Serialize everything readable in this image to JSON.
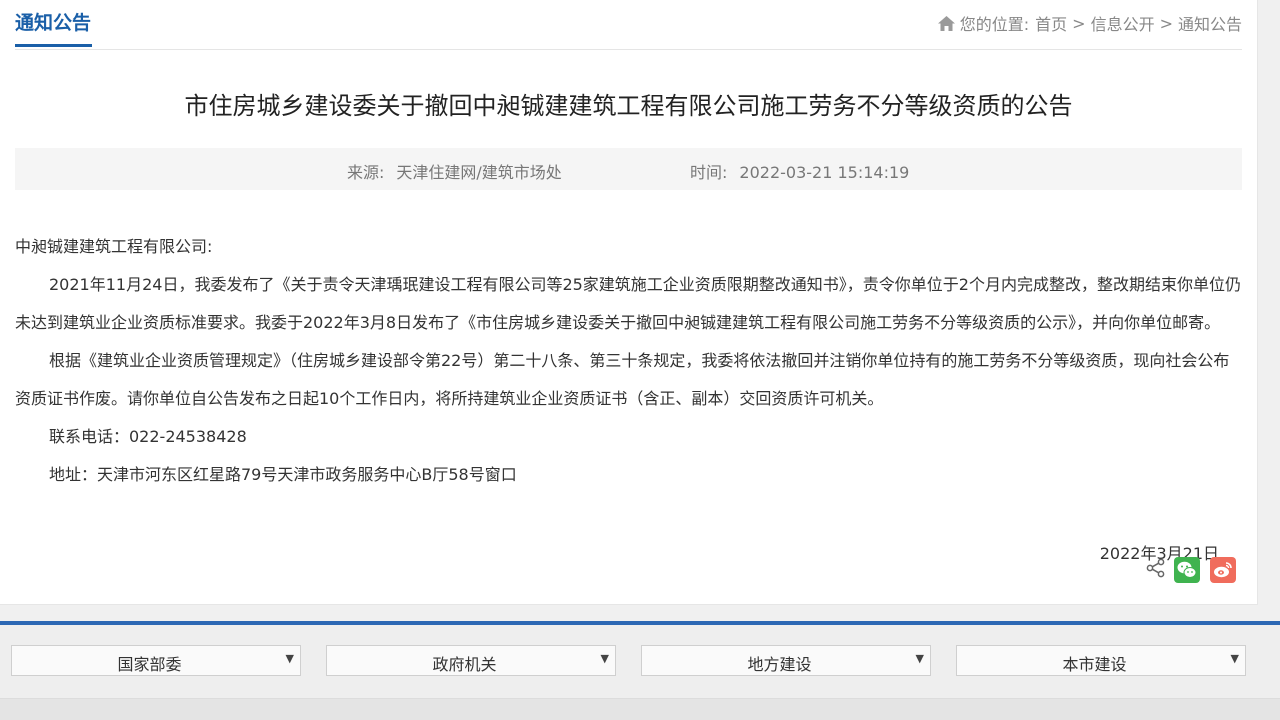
{
  "header": {
    "section_title": "通知公告",
    "breadcrumb_prefix": "您的位置:",
    "breadcrumb": [
      "首页",
      "信息公开",
      "通知公告"
    ],
    "separator": ">"
  },
  "article": {
    "title": "市住房城乡建设委关于撤回中昶铖建建筑工程有限公司施工劳务不分等级资质的公告",
    "source_label": "来源:",
    "source_value": "天津住建网/建筑市场处",
    "time_label": "时间:",
    "time_value": "2022-03-21 15:14:19",
    "salutation": "中昶铖建建筑工程有限公司:",
    "paragraph_1": "2021年11月24日，我委发布了《关于责令天津瑀珉建设工程有限公司等25家建筑施工企业资质限期整改通知书》，责令你单位于2个月内完成整改，整改期结束你单位仍未达到建筑业企业资质标准要求。我委于2022年3月8日发布了《市住房城乡建设委关于撤回中昶铖建建筑工程有限公司施工劳务不分等级资质的公示》，并向你单位邮寄。",
    "paragraph_2": "根据《建筑业企业资质管理规定》（住房城乡建设部令第22号）第二十八条、第三十条规定，我委将依法撤回并注销你单位持有的施工劳务不分等级资质，现向社会公布资质证书作废。请你单位自公告发布之日起10个工作日内，将所持建筑业企业资质证书（含正、副本）交回资质许可机关。",
    "phone": "联系电话：022-24538428",
    "address": "地址：天津市河东区红星路79号天津市政务服务中心B厅58号窗口",
    "sign_date": "2022年3月21日"
  },
  "share": {
    "icons": [
      "share-icon",
      "wechat-icon",
      "weibo-icon"
    ],
    "wechat_color": "#3fb34f",
    "weibo_color": "#f06c5c"
  },
  "footer": {
    "accent_color": "#2c68b4",
    "selects": [
      {
        "label": "国家部委"
      },
      {
        "label": "政府机关"
      },
      {
        "label": "地方建设"
      },
      {
        "label": "本市建设"
      }
    ],
    "arrow": "▼"
  }
}
